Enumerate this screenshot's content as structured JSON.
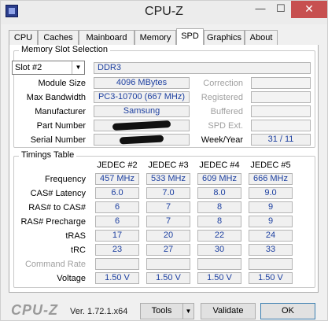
{
  "window": {
    "title": "CPU-Z",
    "min_glyph": "—",
    "max_glyph": "☐",
    "close_glyph": "✕"
  },
  "tabs": [
    {
      "label": "CPU"
    },
    {
      "label": "Caches"
    },
    {
      "label": "Mainboard"
    },
    {
      "label": "Memory"
    },
    {
      "label": "SPD",
      "active": true
    },
    {
      "label": "Graphics"
    },
    {
      "label": "About"
    }
  ],
  "slot_selection": {
    "group_title": "Memory Slot Selection",
    "selected_slot": "Slot #2",
    "memory_type": "DDR3",
    "module_size_label": "Module Size",
    "module_size": "4096 MBytes",
    "max_bandwidth_label": "Max Bandwidth",
    "max_bandwidth": "PC3-10700 (667 MHz)",
    "manufacturer_label": "Manufacturer",
    "manufacturer": "Samsung",
    "part_number_label": "Part Number",
    "serial_number_label": "Serial Number",
    "correction_label": "Correction",
    "registered_label": "Registered",
    "buffered_label": "Buffered",
    "spd_ext_label": "SPD Ext.",
    "week_year_label": "Week/Year",
    "week_year": "31 / 11"
  },
  "timings": {
    "group_title": "Timings Table",
    "columns": [
      "JEDEC #2",
      "JEDEC #3",
      "JEDEC #4",
      "JEDEC #5"
    ],
    "rows": [
      {
        "label": "Frequency",
        "values": [
          "457 MHz",
          "533 MHz",
          "609 MHz",
          "666 MHz"
        ]
      },
      {
        "label": "CAS# Latency",
        "values": [
          "6.0",
          "7.0",
          "8.0",
          "9.0"
        ]
      },
      {
        "label": "RAS# to CAS#",
        "values": [
          "6",
          "7",
          "8",
          "9"
        ]
      },
      {
        "label": "RAS# Precharge",
        "values": [
          "6",
          "7",
          "8",
          "9"
        ]
      },
      {
        "label": "tRAS",
        "values": [
          "17",
          "20",
          "22",
          "24"
        ]
      },
      {
        "label": "tRC",
        "values": [
          "23",
          "27",
          "30",
          "33"
        ]
      },
      {
        "label": "Command Rate",
        "values": [
          "",
          "",
          "",
          ""
        ],
        "disabled": true
      },
      {
        "label": "Voltage",
        "values": [
          "1.50 V",
          "1.50 V",
          "1.50 V",
          "1.50 V"
        ]
      }
    ]
  },
  "footer": {
    "logo": "CPU-Z",
    "version": "Ver. 1.72.1.x64",
    "tools_label": "Tools",
    "validate_label": "Validate",
    "ok_label": "OK"
  },
  "icons": {
    "dropdown": "chevron-down-icon",
    "app": "cpu-z-icon"
  }
}
